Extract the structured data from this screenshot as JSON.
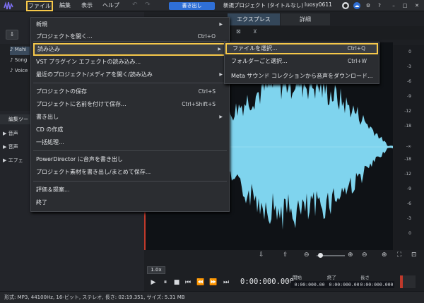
{
  "menubar": {
    "file": "ファイル",
    "edit": "編集",
    "view": "表示",
    "help": "ヘルプ"
  },
  "titlebar": {
    "export": "書き出し",
    "project_title": "新規プロジェクト (タイトルなし)",
    "username": "luosy0611"
  },
  "tabs": {
    "express": "エクスプレス",
    "detail": "詳細"
  },
  "library": {
    "items": [
      "Mahi",
      "Song",
      "Voice"
    ]
  },
  "edit_panel": {
    "header": "編集ツー",
    "rows": [
      "音声",
      "音声",
      "エフェ"
    ]
  },
  "file_menu": {
    "items": [
      {
        "label": "新規",
        "shortcut": "",
        "arrow": "▶"
      },
      {
        "label": "プロジェクトを開く...",
        "shortcut": "Ctrl+O",
        "arrow": ""
      },
      {
        "label": "読み込み",
        "shortcut": "",
        "arrow": "▶"
      },
      {
        "label": "VST プラグイン エフェクトの読み込み...",
        "shortcut": "",
        "arrow": ""
      },
      {
        "label": "最近のプロジェクト/メディアを開く/読み込み",
        "shortcut": "",
        "arrow": "▶"
      },
      {
        "label": "プロジェクトの保存",
        "shortcut": "Ctrl+S",
        "arrow": ""
      },
      {
        "label": "プロジェクトに名前を付けて保存...",
        "shortcut": "Ctrl+Shift+S",
        "arrow": ""
      },
      {
        "label": "書き出し",
        "shortcut": "",
        "arrow": "▶"
      },
      {
        "label": "CD の作成",
        "shortcut": "",
        "arrow": ""
      },
      {
        "label": "一括処理...",
        "shortcut": "",
        "arrow": ""
      },
      {
        "label": "PowerDirector に音声を書き出し",
        "shortcut": "",
        "arrow": ""
      },
      {
        "label": "プロジェクト素材を書き出し/まとめて保存...",
        "shortcut": "",
        "arrow": ""
      },
      {
        "label": "評価＆提案...",
        "shortcut": "",
        "arrow": ""
      },
      {
        "label": "終了",
        "shortcut": "",
        "arrow": ""
      }
    ]
  },
  "import_submenu": {
    "items": [
      {
        "label": "ファイルを選択...",
        "shortcut": "Ctrl+Q"
      },
      {
        "label": "フォルダーごと選択...",
        "shortcut": "Ctrl+W"
      },
      {
        "label": "Meta サウンド コレクションから音声をダウンロード...",
        "shortcut": ""
      }
    ]
  },
  "db_scale": [
    "0",
    "-3",
    "-6",
    "-9",
    "-12",
    "-18",
    "-∞",
    "-18",
    "-12",
    "-9",
    "-6",
    "-3",
    "0"
  ],
  "transport": {
    "speed": "1.0x",
    "timecode": "0:00:000.000",
    "start_label": "開始",
    "end_label": "終了",
    "length_label": "長さ",
    "start": "0:00:000.000",
    "end": "0:00:000.000",
    "length": "0:00:000.000"
  },
  "statusbar": {
    "text": "形式: MP3, 44100Hz, 16-ビット, ステレオ, 長さ: 02:19.351, サイズ: 5.31 MB"
  },
  "colors": {
    "accent": "#2f6fd6",
    "highlight": "#f6c84a",
    "waveform": "#7fd4ee",
    "playhead": "#c0392b"
  }
}
